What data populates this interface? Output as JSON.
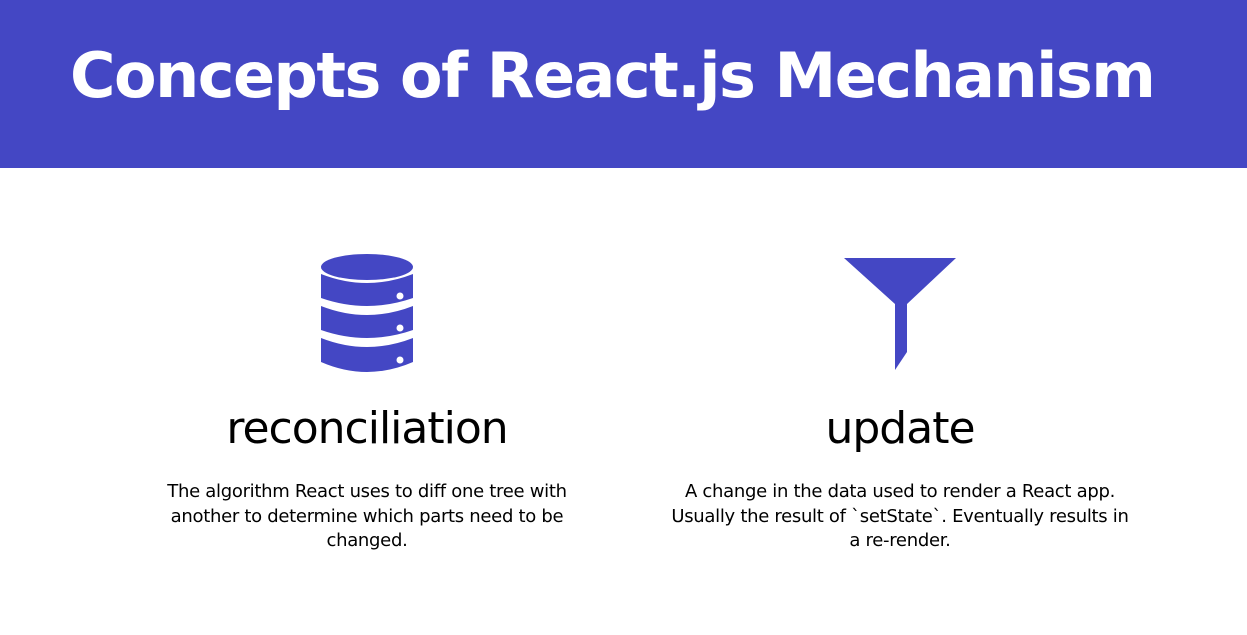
{
  "header": {
    "title": "Concepts of React.js Mechanism",
    "background_color": "#4447c4"
  },
  "concepts": [
    {
      "icon": "database-icon",
      "title": "reconciliation",
      "description": "The algorithm React uses to diff one tree with another to determine which parts need to be changed."
    },
    {
      "icon": "funnel-icon",
      "title": "update",
      "description": "A change in the data used to render a React app. Usually the result of `setState`. Eventually results in a re-render."
    }
  ],
  "colors": {
    "accent": "#4447c4",
    "text": "#000000",
    "background": "#ffffff"
  }
}
